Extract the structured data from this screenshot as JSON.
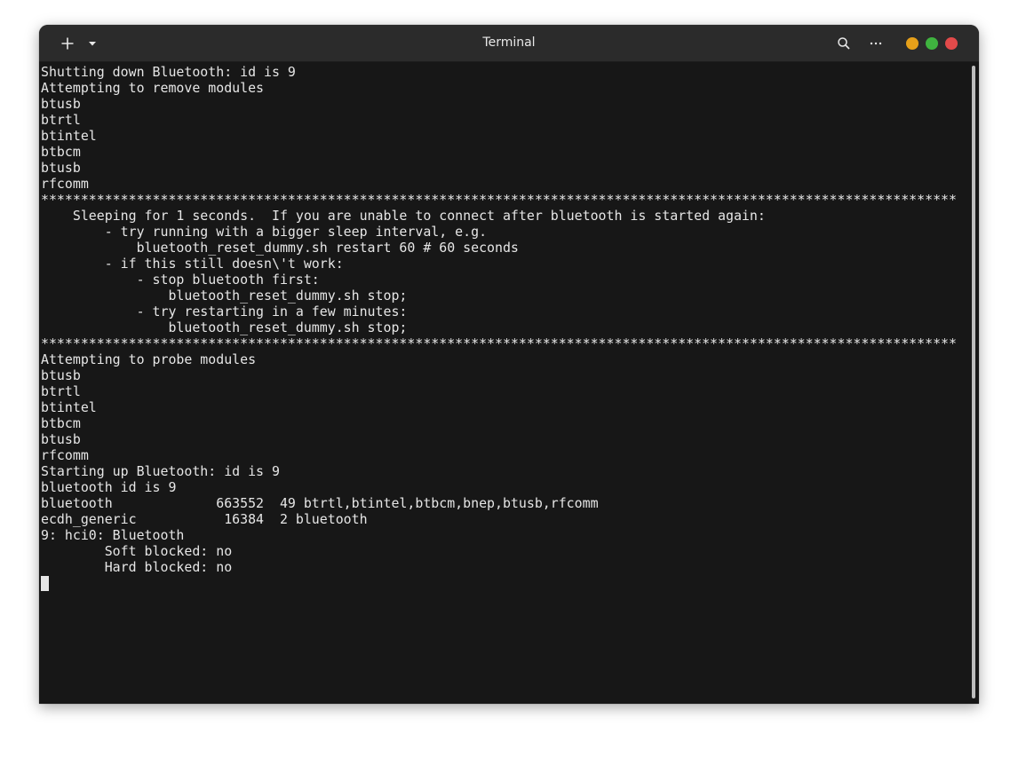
{
  "window": {
    "title": "Terminal"
  },
  "icons": {
    "new_tab": "plus-icon",
    "tab_menu": "caret-down-icon",
    "search": "search-icon",
    "menu": "more-icon",
    "minimize": "minimize-dot",
    "maximize": "maximize-dot",
    "close": "close-dot"
  },
  "colors": {
    "titlebar": "#2b2b2b",
    "terminal_bg": "#171717",
    "text": "#e6e6e6",
    "minimize": "#e6a01a",
    "maximize": "#3fb33f",
    "close": "#e24a4a"
  },
  "terminal": {
    "lines": [
      "Shutting down Bluetooth: id is 9",
      "Attempting to remove modules",
      "btusb",
      "btrtl",
      "btintel",
      "btbcm",
      "btusb",
      "rfcomm",
      "*******************************************************************************************************************",
      "    Sleeping for 1 seconds.  If you are unable to connect after bluetooth is started again:",
      "        - try running with a bigger sleep interval, e.g.",
      "            bluetooth_reset_dummy.sh restart 60 # 60 seconds",
      "        - if this still doesn\\'t work:",
      "            - stop bluetooth first:",
      "                bluetooth_reset_dummy.sh stop;",
      "            - try restarting in a few minutes:",
      "                bluetooth_reset_dummy.sh stop;",
      "*******************************************************************************************************************",
      "Attempting to probe modules",
      "btusb",
      "btrtl",
      "btintel",
      "btbcm",
      "btusb",
      "rfcomm",
      "Starting up Bluetooth: id is 9",
      "bluetooth id is 9",
      "bluetooth             663552  49 btrtl,btintel,btbcm,bnep,btusb,rfcomm",
      "ecdh_generic           16384  2 bluetooth",
      "9: hci0: Bluetooth",
      "        Soft blocked: no",
      "        Hard blocked: no"
    ]
  }
}
